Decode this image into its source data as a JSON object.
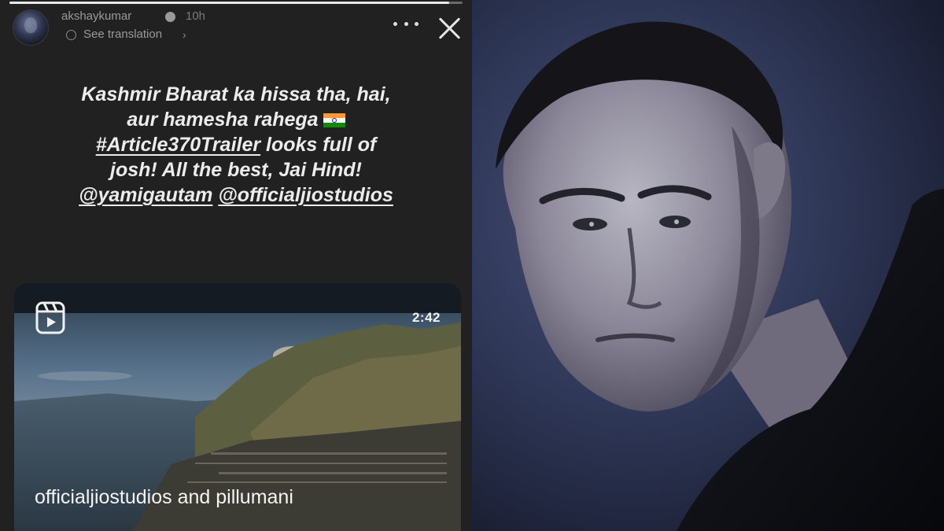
{
  "story": {
    "progress": 0.97,
    "username": "akshaykumar",
    "time_ago": "10h",
    "see_translation": "See translation",
    "caption": {
      "line1": "Kashmir Bharat ka hissa tha, hai,",
      "line2": "aur hamesha rahega",
      "line2_emoji": "indian-flag-emoji",
      "line3_hashtag": "#Article370Trailer",
      "line3_rest": " looks full of",
      "line4": "josh! All the best, Jai Hind!",
      "mention1": "@yamigautam",
      "mention2": "@officialjiostudios"
    },
    "video": {
      "duration": "2:42",
      "collab_text": "officialjiostudios and pillumani",
      "icon": "reels-icon"
    },
    "icons": [
      "more-options-icon",
      "close-icon",
      "globe-icon",
      "chevron-down-icon",
      "verified-badge-icon"
    ]
  },
  "colors": {
    "story_bg": "#212121",
    "caption_text": "#ececec",
    "photo_bg": "#2f3757"
  }
}
